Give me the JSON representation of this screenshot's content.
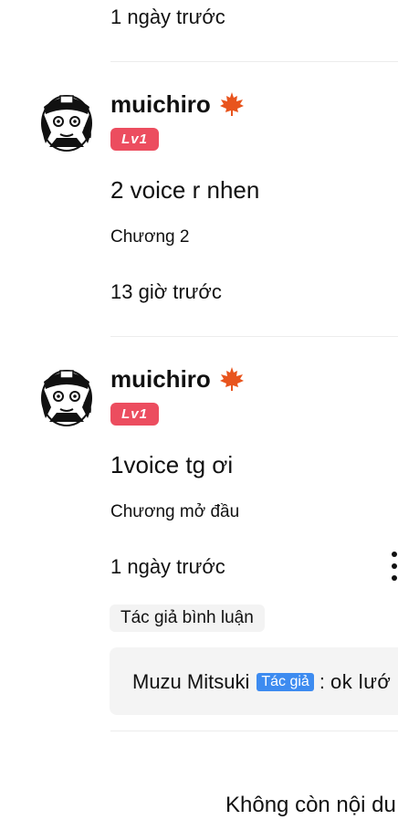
{
  "previous_comment": {
    "time": "1 ngày trước"
  },
  "comments": [
    {
      "username": "muichiro",
      "level": "Lv1",
      "text": "2 voice r nhen",
      "chapter": "Chương 2",
      "time": "13 giờ trước"
    },
    {
      "username": "muichiro",
      "level": "Lv1",
      "text": "1voice tg ơi",
      "chapter": "Chương mở đầu",
      "time": "1 ngày trước",
      "author_reply_label": "Tác giả bình luận",
      "author_reply": {
        "author_name": "Muzu Mitsuki",
        "author_badge": "Tác giả",
        "separator": ":",
        "text": "ok lướ"
      }
    }
  ],
  "footer": {
    "end_text": "Không còn nội du"
  },
  "colors": {
    "level_badge": "#ec4d5f",
    "author_badge": "#3d8bf0",
    "maple_leaf": "#e8541d",
    "reply_background": "#f4f4f4"
  },
  "icons": {
    "user_badge": "maple-leaf-icon",
    "more": "more-vertical-icon"
  }
}
